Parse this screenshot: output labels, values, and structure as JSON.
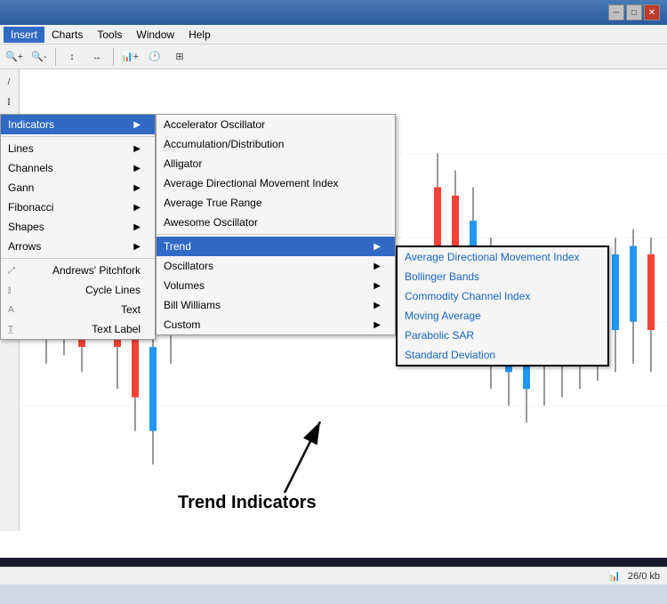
{
  "titleBar": {
    "title": "",
    "buttons": [
      "minimize",
      "maximize",
      "close"
    ]
  },
  "menuBar": {
    "items": [
      "Insert",
      "Charts",
      "Tools",
      "Window",
      "Help"
    ]
  },
  "sidebar": {
    "icons": [
      "diagonal-line",
      "horizontal-lines",
      "cycle-lines",
      "A-text",
      "text-label"
    ]
  },
  "insertMenu": {
    "items": [
      {
        "label": "Indicators",
        "hasSubmenu": true
      },
      {
        "label": "Lines",
        "hasSubmenu": true
      },
      {
        "label": "Channels",
        "hasSubmenu": true
      },
      {
        "label": "Gann",
        "hasSubmenu": true
      },
      {
        "label": "Fibonacci",
        "hasSubmenu": true
      },
      {
        "label": "Shapes",
        "hasSubmenu": true
      },
      {
        "label": "Arrows",
        "hasSubmenu": true
      },
      {
        "label": "Andrews' Pitchfork",
        "hasSubmenu": false
      },
      {
        "label": "Cycle Lines",
        "hasSubmenu": false
      },
      {
        "label": "Text",
        "hasSubmenu": false
      },
      {
        "label": "Text Label",
        "hasSubmenu": false
      }
    ]
  },
  "indicatorsSubmenu": {
    "items": [
      {
        "label": "Accelerator Oscillator",
        "hasSubmenu": false
      },
      {
        "label": "Accumulation/Distribution",
        "hasSubmenu": false
      },
      {
        "label": "Alligator",
        "hasSubmenu": false
      },
      {
        "label": "Average Directional Movement Index",
        "hasSubmenu": false
      },
      {
        "label": "Average True Range",
        "hasSubmenu": false
      },
      {
        "label": "Awesome Oscillator",
        "hasSubmenu": false
      },
      {
        "label": "Trend",
        "hasSubmenu": true,
        "highlighted": true
      },
      {
        "label": "Oscillators",
        "hasSubmenu": true
      },
      {
        "label": "Volumes",
        "hasSubmenu": true
      },
      {
        "label": "Bill Williams",
        "hasSubmenu": true
      },
      {
        "label": "Custom",
        "hasSubmenu": true
      }
    ]
  },
  "trendSubmenu": {
    "items": [
      {
        "label": "Average Directional Movement Index"
      },
      {
        "label": "Bollinger Bands"
      },
      {
        "label": "Commodity Channel Index"
      },
      {
        "label": "Moving Average"
      },
      {
        "label": "Parabolic SAR"
      },
      {
        "label": "Standard Deviation"
      }
    ]
  },
  "annotation": {
    "text": "Trend Indicators"
  },
  "statusBar": {
    "chartType": "26/0 kb"
  }
}
